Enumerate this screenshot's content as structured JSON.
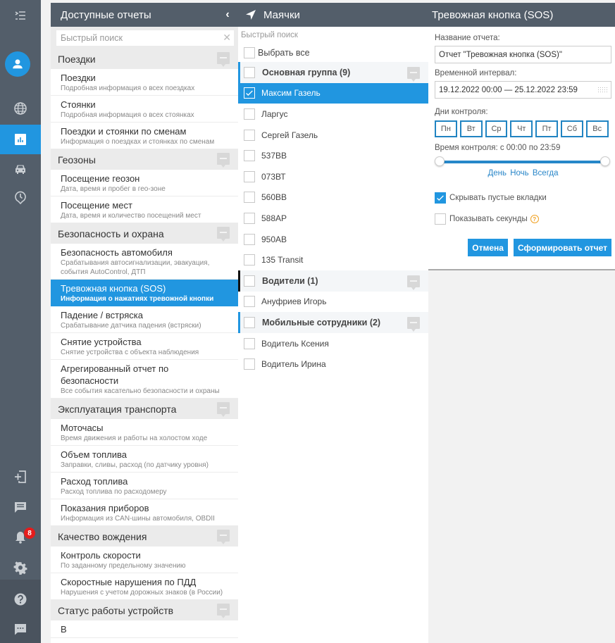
{
  "rail": {
    "notification_count": "8",
    "items": [
      {
        "icon": "menu-expand-icon"
      },
      {
        "icon": "user-avatar-icon"
      },
      {
        "icon": "globe-icon"
      },
      {
        "icon": "reports-chart-icon",
        "active": true
      },
      {
        "icon": "car-icon"
      },
      {
        "icon": "history-pin-icon"
      },
      {
        "icon": "login-icon"
      },
      {
        "icon": "messages-icon"
      },
      {
        "icon": "bell-icon"
      },
      {
        "icon": "gear-icon"
      },
      {
        "icon": "help-icon"
      },
      {
        "icon": "chat-icon"
      }
    ]
  },
  "reports": {
    "title": "Доступные отчеты",
    "search_placeholder": "Быстрый поиск",
    "categories": [
      {
        "name": "Поездки",
        "items": [
          {
            "title": "Поездки",
            "desc": "Подробная информация о всех поездках"
          },
          {
            "title": "Стоянки",
            "desc": "Подробная информация о всех стоянках"
          },
          {
            "title": "Поездки и стоянки по сменам",
            "desc": "Информация о поездках и стоянках по сменам"
          }
        ]
      },
      {
        "name": "Геозоны",
        "items": [
          {
            "title": "Посещение геозон",
            "desc": "Дата, время и пробег в гео-зоне"
          },
          {
            "title": "Посещение мест",
            "desc": "Дата, время и количество посещений мест"
          }
        ]
      },
      {
        "name": "Безопасность и охрана",
        "items": [
          {
            "title": "Безопасность автомобиля",
            "desc": "Срабатывания автосигнализации, эвакуация, события AutoControl, ДТП"
          },
          {
            "title": "Тревожная кнопка (SOS)",
            "desc": "Информация о нажатиях тревожной кнопки",
            "active": true
          },
          {
            "title": "Падение / встряска",
            "desc": "Срабатывание датчика падения (встряски)"
          },
          {
            "title": "Снятие устройства",
            "desc": "Снятие устройства с объекта наблюдения"
          },
          {
            "title": "Агрегированный отчет по безопасности",
            "desc": "Все события касательно безопасности и охраны"
          }
        ]
      },
      {
        "name": "Эксплуатация транспорта",
        "items": [
          {
            "title": "Моточасы",
            "desc": "Время движения и работы на холостом ходе"
          },
          {
            "title": "Объем топлива",
            "desc": "Заправки, сливы, расход (по датчику уровня)"
          },
          {
            "title": "Расход топлива",
            "desc": "Расход топлива по расходомеру"
          },
          {
            "title": "Показания приборов",
            "desc": "Информация из CAN-шины автомобиля, OBDII"
          }
        ]
      },
      {
        "name": "Качество вождения",
        "items": [
          {
            "title": "Контроль скорости",
            "desc": "По заданному предельному значению"
          },
          {
            "title": "Скоростные нарушения по ПДД",
            "desc": "Нарушения с учетом дорожных знаков (в России)"
          }
        ]
      },
      {
        "name": "Статус работы устройств",
        "items": [
          {
            "title": "В",
            "desc": ""
          }
        ]
      }
    ]
  },
  "trackers": {
    "title": "Маячки",
    "search_placeholder": "Быстрый поиск",
    "select_all": "Выбрать все",
    "rows": [
      {
        "type": "group",
        "label": "Основная группа (9)",
        "bar": "#2196e0"
      },
      {
        "type": "item",
        "label": "Максим Газель",
        "checked": true
      },
      {
        "type": "item",
        "label": "Ларгус"
      },
      {
        "type": "item",
        "label": "Сергей Газель"
      },
      {
        "type": "item",
        "label": "537ВВ"
      },
      {
        "type": "item",
        "label": "073ВТ"
      },
      {
        "type": "item",
        "label": "560ВВ"
      },
      {
        "type": "item",
        "label": "588АР"
      },
      {
        "type": "item",
        "label": "950АВ"
      },
      {
        "type": "item",
        "label": "135 Transit"
      },
      {
        "type": "group",
        "label": "Водители (1)",
        "bar": "#111111"
      },
      {
        "type": "item",
        "label": "Ануфриев Игорь"
      },
      {
        "type": "group",
        "label": "Мобильные сотрудники (2)",
        "bar": "#2196e0"
      },
      {
        "type": "item",
        "label": "Водитель Ксения"
      },
      {
        "type": "item",
        "label": "Водитель Ирина"
      }
    ]
  },
  "form": {
    "title": "Тревожная кнопка (SOS)",
    "name_label": "Название отчета:",
    "name_value": "Отчет \"Тревожная кнопка (SOS)\"",
    "interval_label": "Временной интервал:",
    "interval_value": "19.12.2022 00:00 — 25.12.2022 23:59",
    "days_label": "Дни контроля:",
    "days": [
      "Пн",
      "Вт",
      "Ср",
      "Чт",
      "Пт",
      "Сб",
      "Вс"
    ],
    "time_label": "Время контроля: с 00:00 по 23:59",
    "time_range_fraction": [
      0.0,
      1.0
    ],
    "presets": [
      "День",
      "Ночь",
      "Всегда"
    ],
    "hide_empty_label": "Скрывать пустые вкладки",
    "hide_empty_checked": true,
    "show_seconds_label": "Показывать секунды",
    "show_seconds_checked": false,
    "cancel_label": "Отмена",
    "submit_label": "Сформировать отчет"
  }
}
